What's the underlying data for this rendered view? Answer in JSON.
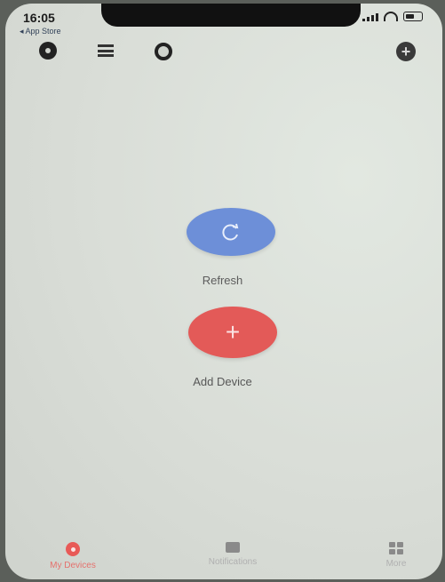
{
  "status_bar": {
    "time": "16:05",
    "back_label": "◂ App Store"
  },
  "toolbar": {
    "icons": [
      "record-icon",
      "list-icon",
      "ring-icon",
      "add-icon"
    ],
    "plus_glyph": "+"
  },
  "main": {
    "refresh_label": "Refresh",
    "add_device_label": "Add Device",
    "refresh_color": "#6d8fd8",
    "add_color": "#e35a58",
    "plus_glyph": "+"
  },
  "tabbar": {
    "home_label": "My Devices",
    "notifications_label": "Notifications",
    "more_label": "More",
    "active_color": "#e5716d"
  }
}
